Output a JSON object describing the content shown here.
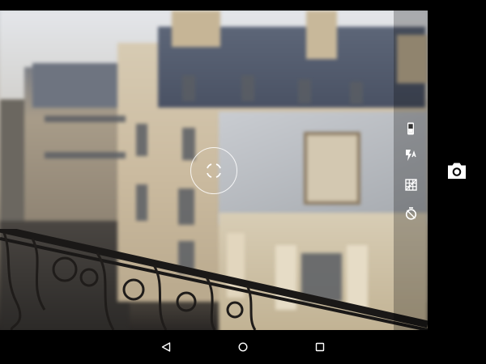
{
  "app": {
    "name": "Camera"
  },
  "controls": {
    "icons": [
      "phone-orientation-icon",
      "flash-auto-icon",
      "grid-lines-icon",
      "countdown-timer-icon"
    ]
  },
  "shutter": {
    "icon": "camera-icon"
  },
  "navigation": {
    "icons": [
      "back-icon",
      "home-icon",
      "recents-icon"
    ]
  },
  "colors": {
    "panel": "#000000",
    "icon": "#ffffff"
  }
}
